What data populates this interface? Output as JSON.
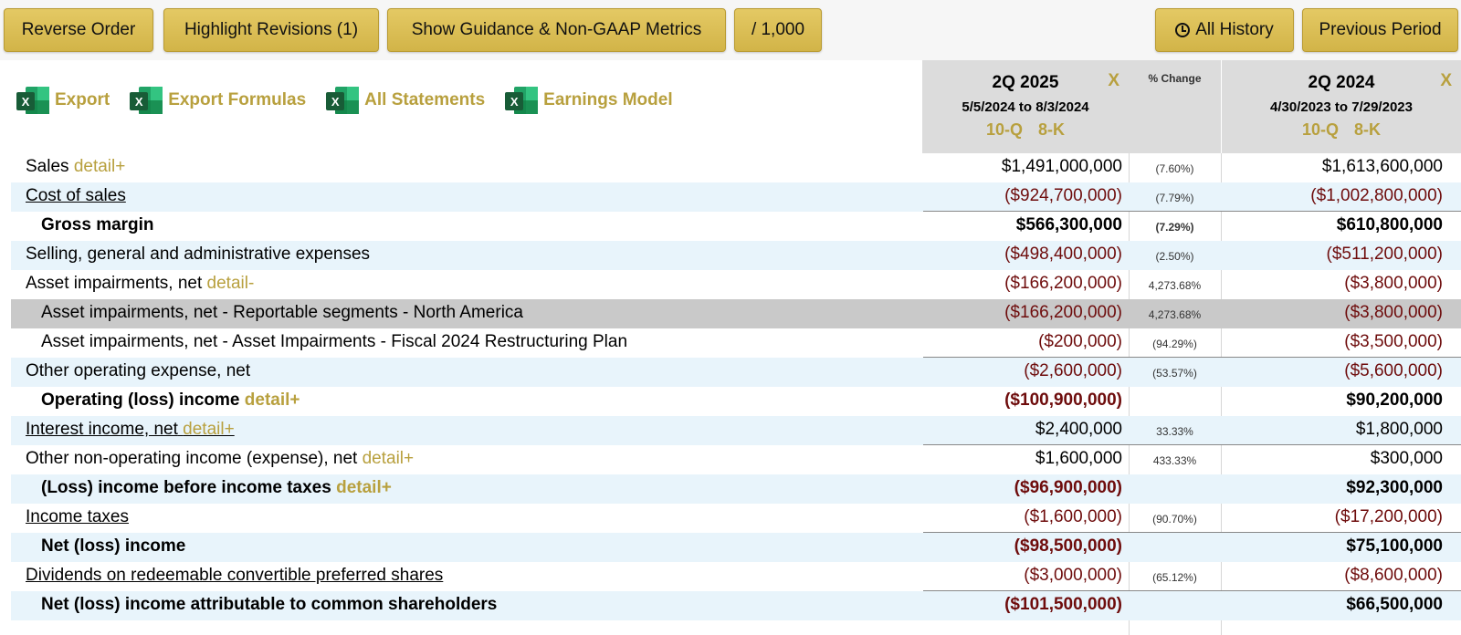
{
  "toolbar": {
    "reverse_order": "Reverse Order",
    "highlight_revisions": "Highlight Revisions (1)",
    "show_guidance": "Show Guidance & Non-GAAP Metrics",
    "scale": "/ 1,000",
    "all_history": "All History",
    "previous_period": "Previous Period"
  },
  "exports": {
    "export": "Export",
    "export_formulas": "Export Formulas",
    "all_statements": "All Statements",
    "earnings_model": "Earnings Model",
    "xl_letter": "X"
  },
  "columns": {
    "current": {
      "title": "2Q 2025",
      "range": "5/5/2024 to 8/3/2024",
      "link1": "10-Q",
      "link2": "8-K",
      "close": "X"
    },
    "pct_change": "% Change",
    "prior": {
      "title": "2Q 2024",
      "range": "4/30/2023 to 7/29/2023",
      "link1": "10-Q",
      "link2": "8-K",
      "close": "X"
    }
  },
  "rows": [
    {
      "label": "Sales",
      "detail": "detail+",
      "v1": "$1,491,000,000",
      "pct": "(7.60%)",
      "v2": "$1,613,600,000"
    },
    {
      "label": "Cost of sales",
      "detail": "",
      "v1": "($924,700,000)",
      "pct": "(7.79%)",
      "v2": "($1,002,800,000)"
    },
    {
      "label": "Gross margin",
      "detail": "",
      "v1": "$566,300,000",
      "pct": "(7.29%)",
      "v2": "$610,800,000"
    },
    {
      "label": "Selling, general and administrative expenses",
      "detail": "",
      "v1": "($498,400,000)",
      "pct": "(2.50%)",
      "v2": "($511,200,000)"
    },
    {
      "label": "Asset impairments, net",
      "detail": "detail-",
      "v1": "($166,200,000)",
      "pct": "4,273.68%",
      "v2": "($3,800,000)"
    },
    {
      "label": "Asset impairments, net - Reportable segments - North America",
      "detail": "",
      "v1": "($166,200,000)",
      "pct": "4,273.68%",
      "v2": "($3,800,000)"
    },
    {
      "label": "Asset impairments, net - Asset Impairments - Fiscal 2024 Restructuring Plan",
      "detail": "",
      "v1": "($200,000)",
      "pct": "(94.29%)",
      "v2": "($3,500,000)"
    },
    {
      "label": "Other operating expense, net",
      "detail": "",
      "v1": "($2,600,000)",
      "pct": "(53.57%)",
      "v2": "($5,600,000)"
    },
    {
      "label": "Operating (loss) income",
      "detail": "detail+",
      "v1": "($100,900,000)",
      "pct": "",
      "v2": "$90,200,000"
    },
    {
      "label": "Interest income, net",
      "detail": "detail+",
      "v1": "$2,400,000",
      "pct": "33.33%",
      "v2": "$1,800,000"
    },
    {
      "label": "Other non-operating income (expense), net",
      "detail": "detail+",
      "v1": "$1,600,000",
      "pct": "433.33%",
      "v2": "$300,000"
    },
    {
      "label": "(Loss) income before income taxes",
      "detail": "detail+",
      "v1": "($96,900,000)",
      "pct": "",
      "v2": "$92,300,000"
    },
    {
      "label": "Income taxes",
      "detail": "",
      "v1": "($1,600,000)",
      "pct": "(90.70%)",
      "v2": "($17,200,000)"
    },
    {
      "label": "Net (loss) income",
      "detail": "",
      "v1": "($98,500,000)",
      "pct": "",
      "v2": "$75,100,000"
    },
    {
      "label": "Dividends on redeemable convertible preferred shares",
      "detail": "",
      "v1": "($3,000,000)",
      "pct": "(65.12%)",
      "v2": "($8,600,000)"
    },
    {
      "label": "Net (loss) income attributable to common shareholders",
      "detail": "",
      "v1": "($101,500,000)",
      "pct": "",
      "v2": "$66,500,000"
    }
  ],
  "colors": {
    "accent_gold": "#b8a03e",
    "negative": "#6e0c0c",
    "alt_row": "#e8f4fb",
    "button": "#d9bc52"
  }
}
